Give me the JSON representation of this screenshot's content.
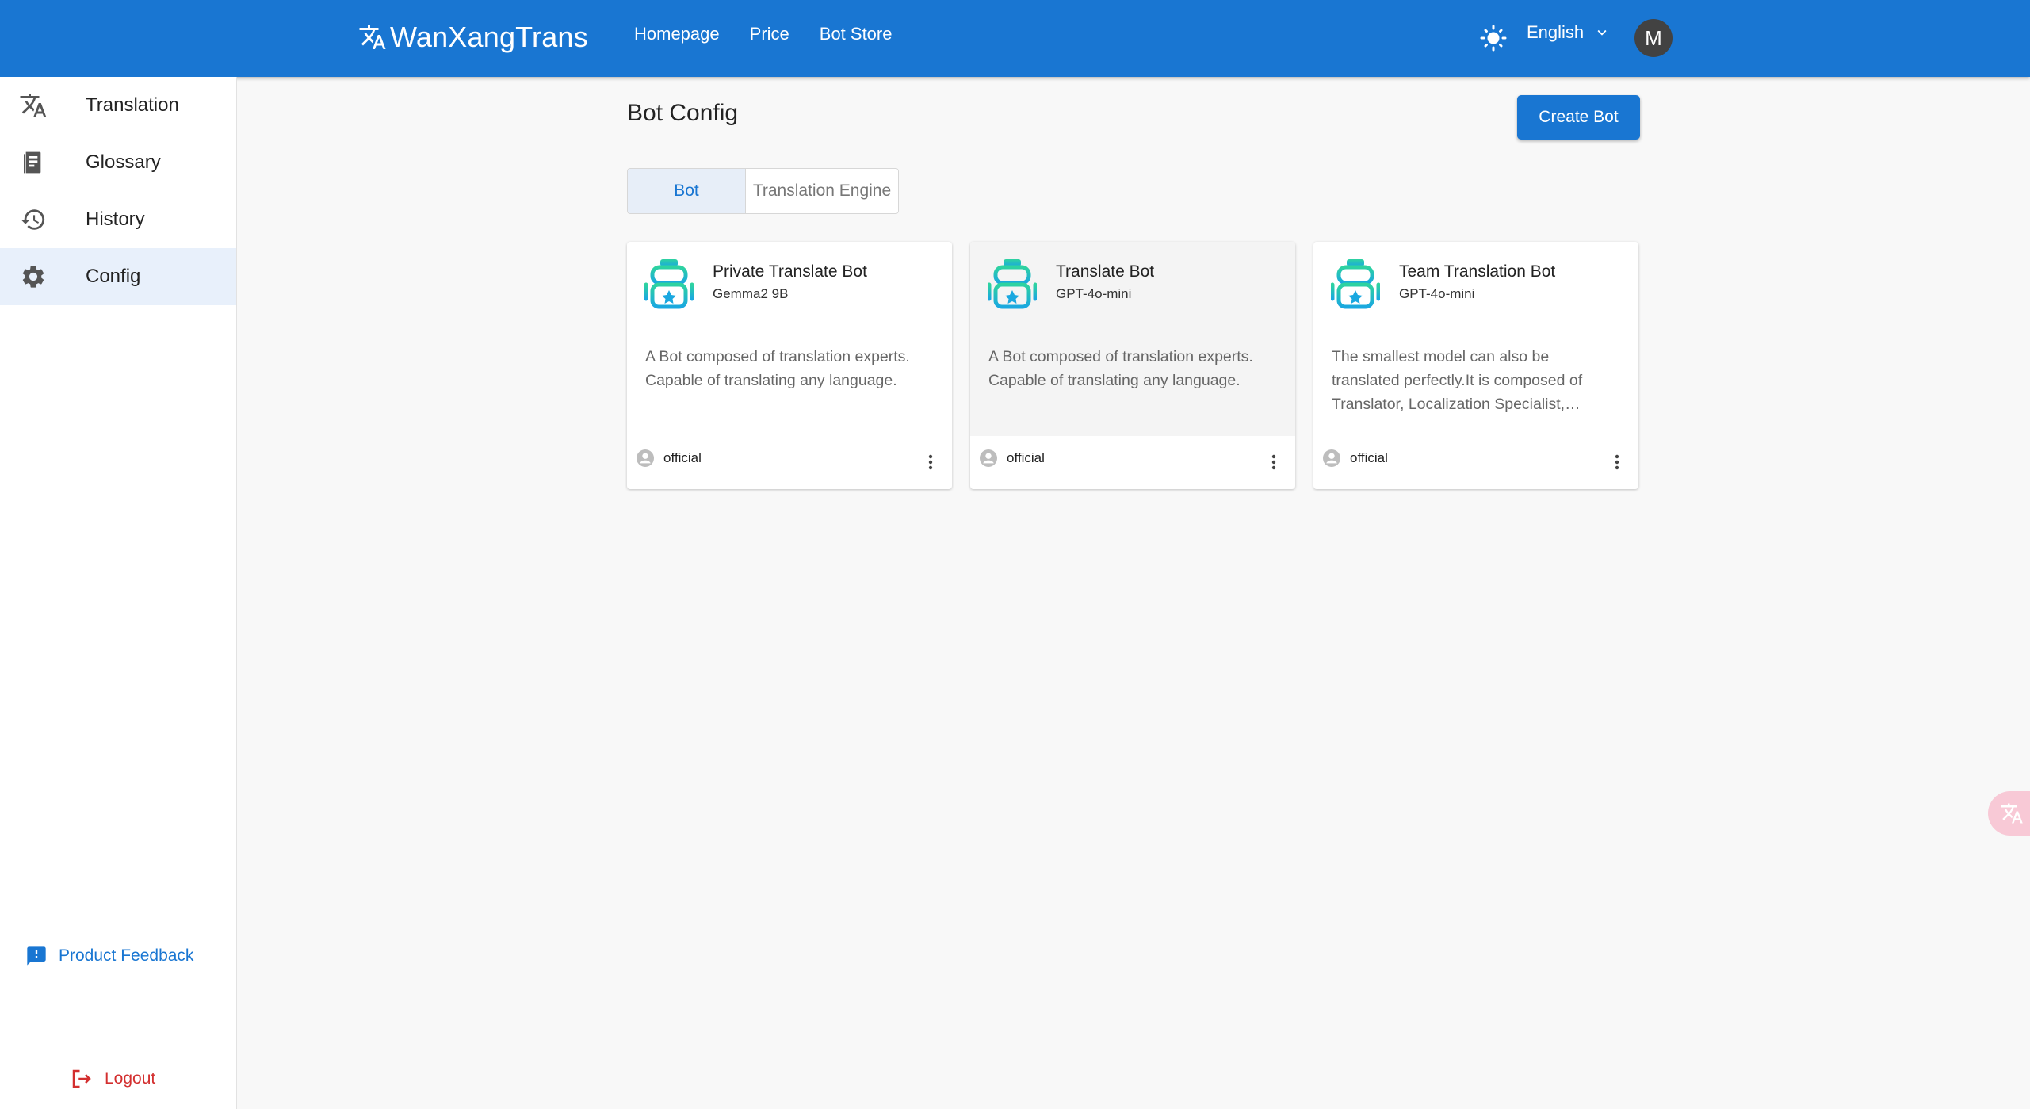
{
  "header": {
    "brand": "WanXangTrans",
    "nav": [
      "Homepage",
      "Price",
      "Bot Store"
    ],
    "language": "English",
    "avatar_initial": "M",
    "color": "#1976d2"
  },
  "sidebar": {
    "items": [
      {
        "label": "Translation",
        "icon": "translate-icon"
      },
      {
        "label": "Glossary",
        "icon": "book-icon"
      },
      {
        "label": "History",
        "icon": "history-icon"
      },
      {
        "label": "Config",
        "icon": "gear-icon",
        "active": true
      }
    ],
    "feedback": "Product Feedback",
    "logout": "Logout"
  },
  "main": {
    "title": "Bot Config",
    "create_button": "Create Bot",
    "tabs": [
      {
        "label": "Bot",
        "selected": true
      },
      {
        "label": "Translation Engine",
        "selected": false
      }
    ],
    "cards": [
      {
        "title": "Private Translate Bot",
        "model": "Gemma2 9B",
        "description": "A Bot composed of translation experts. Capable of translating any language.",
        "author": "official"
      },
      {
        "title": "Translate Bot",
        "model": "GPT-4o-mini",
        "description": "A Bot composed of translation experts. Capable of translating any language.",
        "author": "official"
      },
      {
        "title": "Team Translation Bot",
        "model": "GPT-4o-mini",
        "description": "The smallest model can also be translated perfectly.It is composed of Translator, Localization Specialist, Proofreader and more.",
        "author": "official"
      }
    ]
  }
}
